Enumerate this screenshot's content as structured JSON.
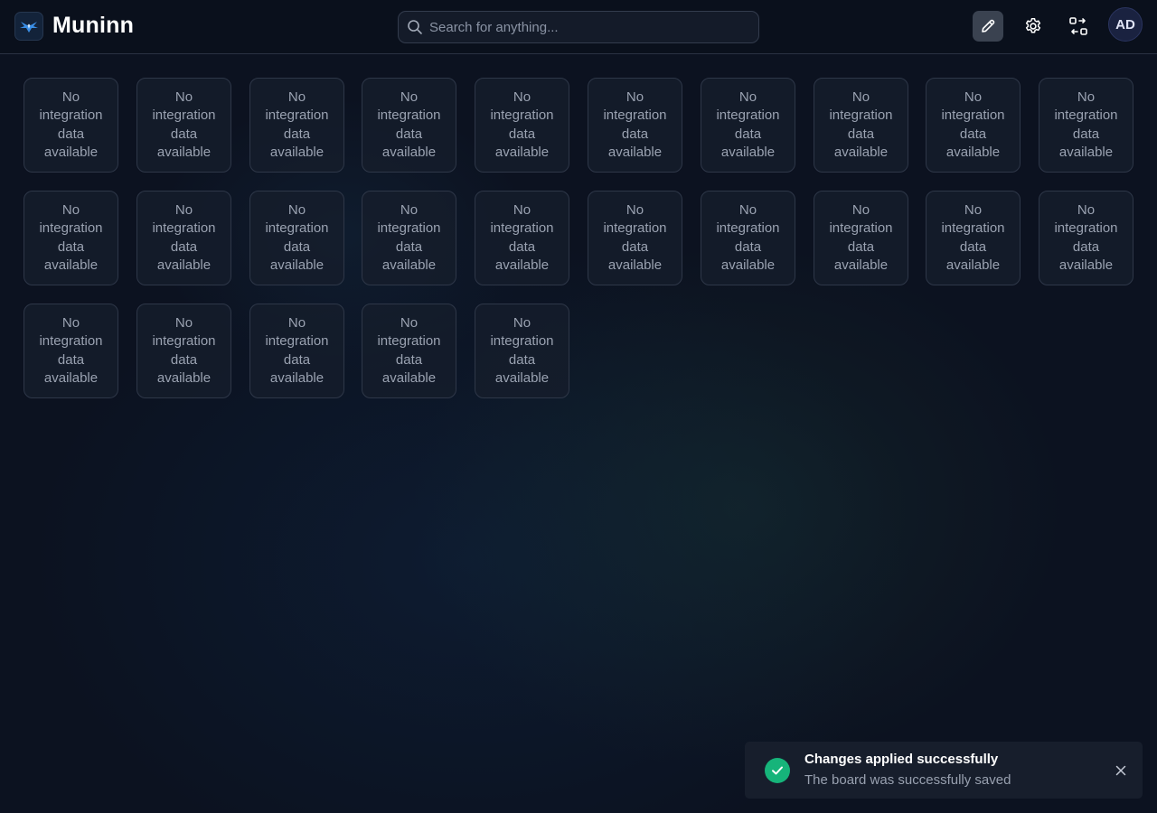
{
  "app": {
    "title": "Muninn",
    "logo_icon": "raven-icon"
  },
  "header": {
    "search": {
      "placeholder": "Search for anything...",
      "value": ""
    },
    "actions": [
      {
        "name": "edit-button",
        "icon": "pencil-icon",
        "active": true
      },
      {
        "name": "settings-button",
        "icon": "gear-icon",
        "active": false
      },
      {
        "name": "switch-board-button",
        "icon": "arrows-swap-icon",
        "active": false
      }
    ],
    "avatar": {
      "initials": "AD"
    }
  },
  "board": {
    "tiles": [
      "No integration data available",
      "No integration data available",
      "No integration data available",
      "No integration data available",
      "No integration data available",
      "No integration data available",
      "No integration data available",
      "No integration data available",
      "No integration data available",
      "No integration data available",
      "No integration data available",
      "No integration data available",
      "No integration data available",
      "No integration data available",
      "No integration data available",
      "No integration data available",
      "No integration data available",
      "No integration data available",
      "No integration data available",
      "No integration data available",
      "No integration data available",
      "No integration data available",
      "No integration data available",
      "No integration data available",
      "No integration data available"
    ]
  },
  "toast": {
    "icon": "check-circle-icon",
    "title": "Changes applied successfully",
    "message": "The board was successfully saved",
    "close_icon": "close-icon",
    "status_color": "#16b47a"
  },
  "colors": {
    "background": "#0c1220",
    "tile_border": "#2e3748",
    "accent": "#3a8ee6"
  }
}
